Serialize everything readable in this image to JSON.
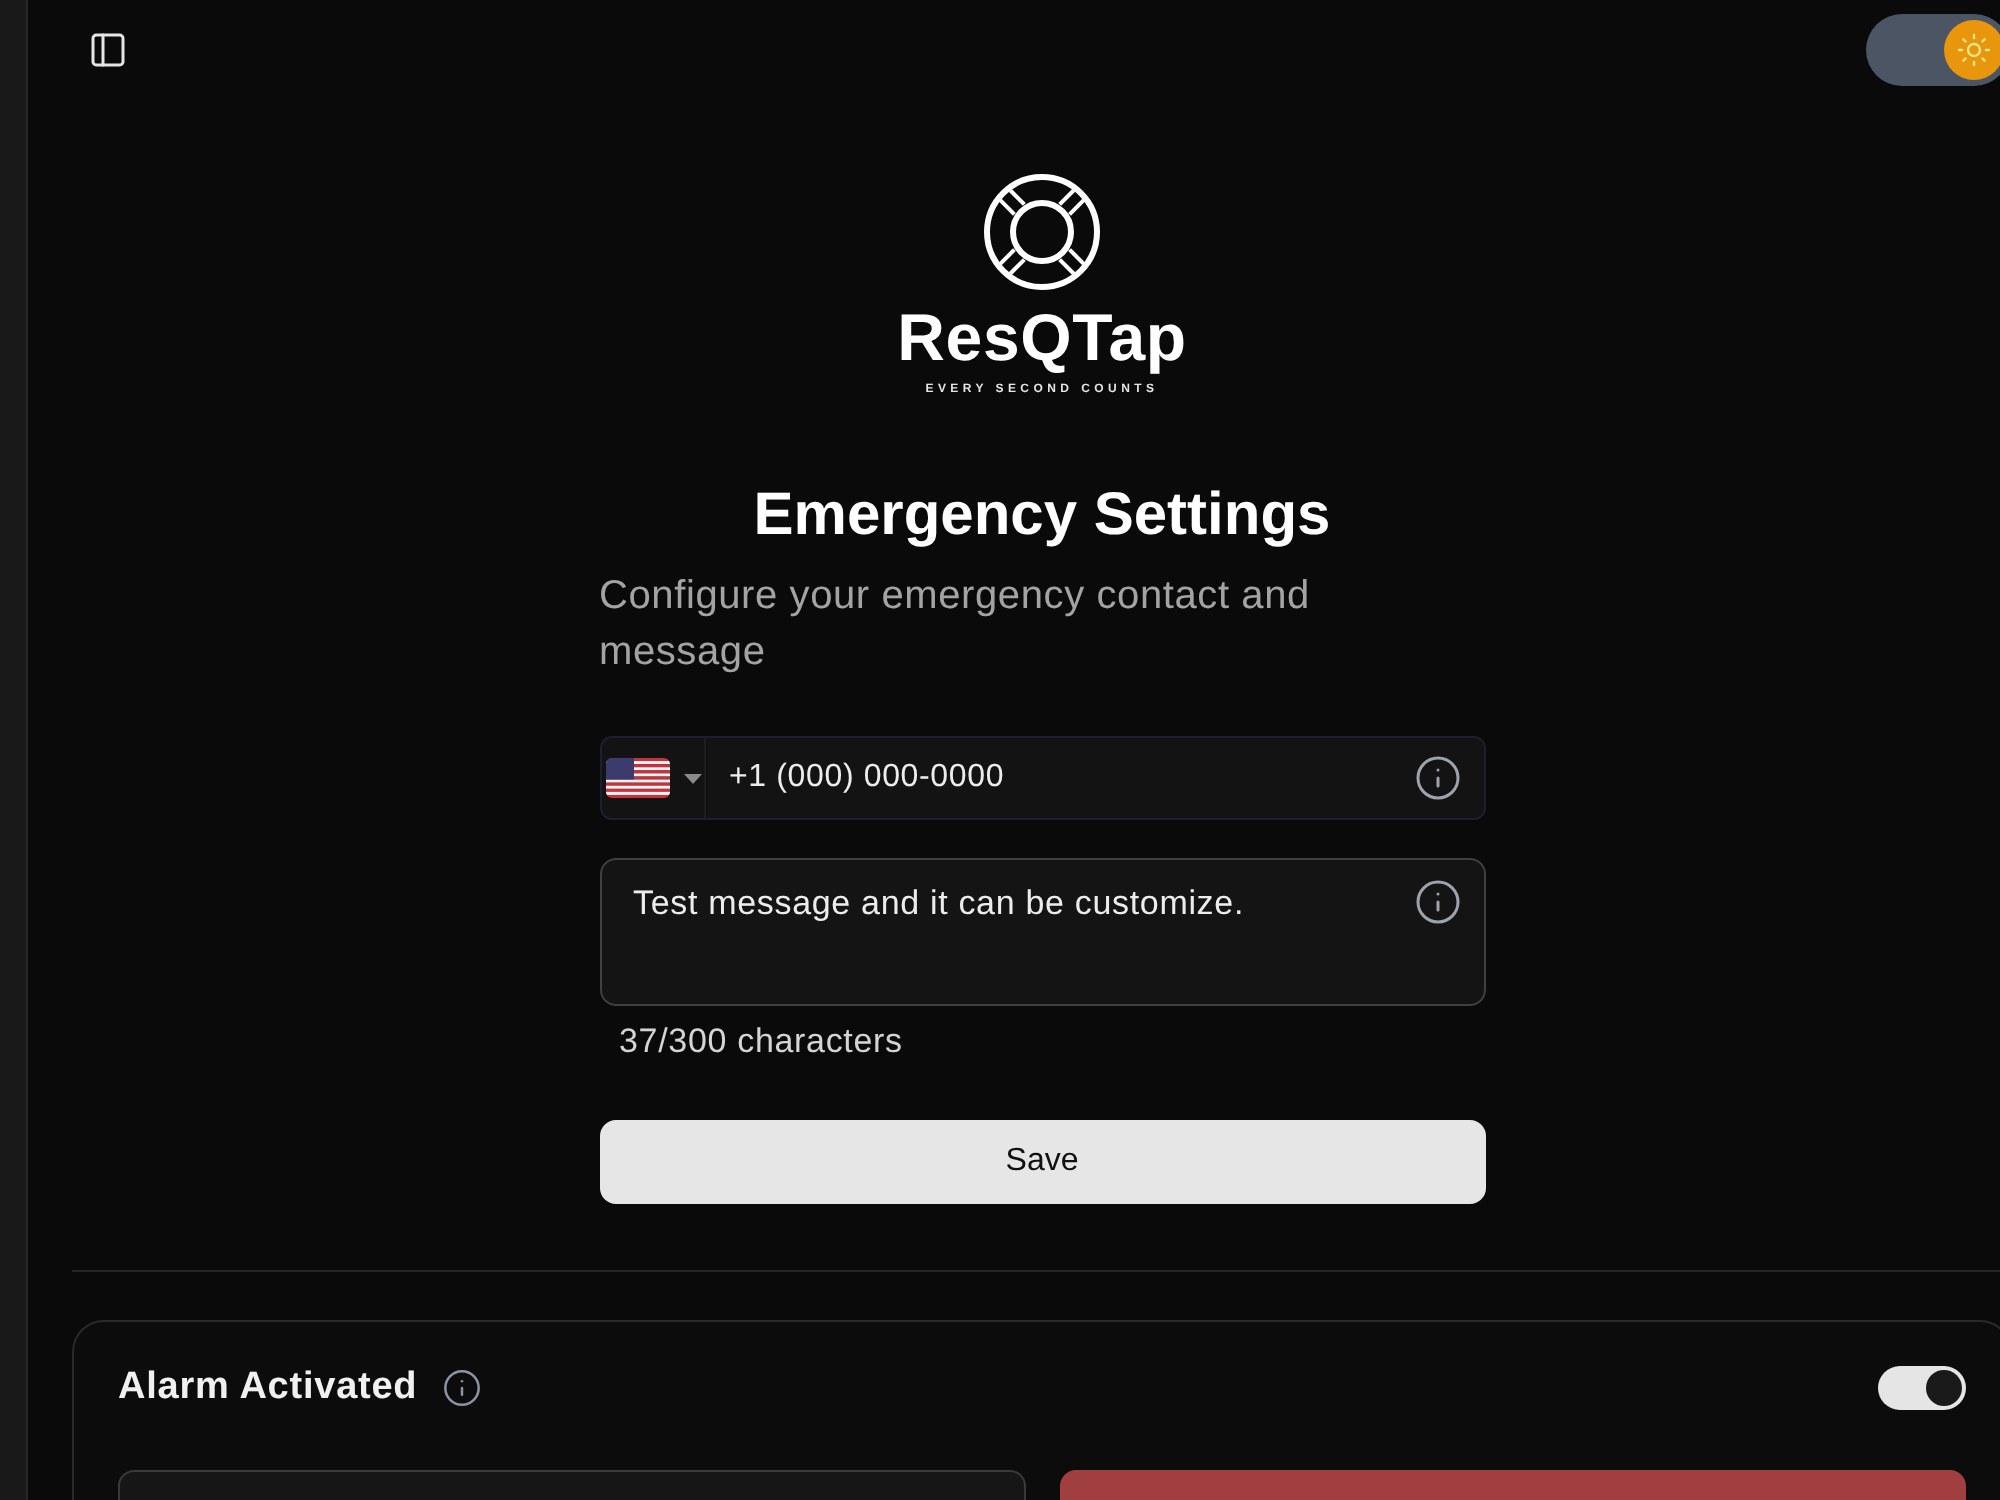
{
  "theme_toggle": {
    "on": true
  },
  "logo": {
    "name": "ResQTap",
    "tagline": "EVERY SECOND COUNTS"
  },
  "title": "Emergency Settings",
  "subtitle": "Configure your emergency contact and message",
  "phone_field": {
    "value": "+1 (000) 000-0000"
  },
  "message_field": {
    "value": "Test message and it can be customize."
  },
  "char_count": "37/300 characters",
  "save_button": "Save",
  "alarm": {
    "label": "Alarm Activated",
    "on": true
  },
  "action_buttons": [
    {
      "kind": "secondary"
    },
    {
      "kind": "danger"
    }
  ]
}
